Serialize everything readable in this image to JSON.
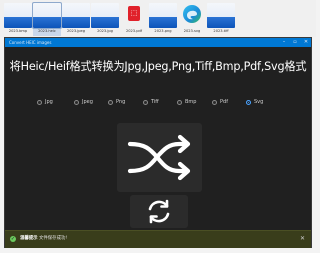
{
  "files": [
    {
      "name": "2023.bmp",
      "kind": "image"
    },
    {
      "name": "2023.heic",
      "kind": "image"
    },
    {
      "name": "2023.jpeg",
      "kind": "image"
    },
    {
      "name": "2023.jpg",
      "kind": "image"
    },
    {
      "name": "2023.pdf",
      "kind": "pdf"
    },
    {
      "name": "2023.png",
      "kind": "image"
    },
    {
      "name": "2023.svg",
      "kind": "edge"
    },
    {
      "name": "2023.tiff",
      "kind": "image"
    }
  ],
  "window": {
    "title": "Convert HEIC images",
    "heading": "将Heic/Heif格式转换为Jpg,Jpeg,Png,Tiff,Bmp,Pdf,Svg格式"
  },
  "formats": [
    {
      "label": "Jpg",
      "selected": false
    },
    {
      "label": "Jpeg",
      "selected": false
    },
    {
      "label": "Png",
      "selected": false
    },
    {
      "label": "Tiff",
      "selected": false
    },
    {
      "label": "Bmp",
      "selected": false
    },
    {
      "label": "Pdf",
      "selected": false
    },
    {
      "label": "Svg",
      "selected": true
    }
  ],
  "status": {
    "title": "温馨提示",
    "message": "文件保存成功!",
    "accent": "#6ccb5f"
  },
  "icons": {
    "convert": "shuffle-icon",
    "refresh": "refresh-icon",
    "status": "checkmark-icon",
    "close": "close-icon"
  }
}
